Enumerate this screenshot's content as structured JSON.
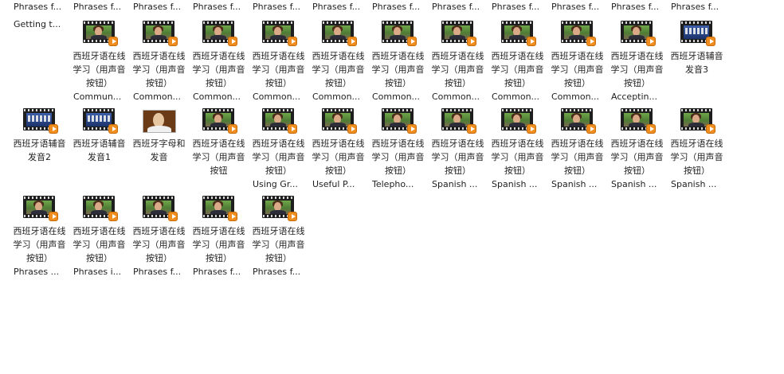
{
  "top_row": [
    "Phrases f...",
    "Phrases f...",
    "Phrases f...",
    "Phrases f...",
    "Phrases f...",
    "Phrases f...",
    "Phrases f...",
    "Phrases f...",
    "Phrases f...",
    "Phrases f...",
    "Phrases f...",
    "Phrases f...",
    "Getting t..."
  ],
  "rows": [
    [
      {
        "thumb": "video",
        "name": "西班牙语在线学习（用声音按钮）",
        "sub": "Commun..."
      },
      {
        "thumb": "video",
        "name": "西班牙语在线学习（用声音按钮）",
        "sub": "Common..."
      },
      {
        "thumb": "video",
        "name": "西班牙语在线学习（用声音按钮）",
        "sub": "Common..."
      },
      {
        "thumb": "video",
        "name": "西班牙语在线学习（用声音按钮）",
        "sub": "Common..."
      },
      {
        "thumb": "video",
        "name": "西班牙语在线学习（用声音按钮）",
        "sub": "Common..."
      },
      {
        "thumb": "video",
        "name": "西班牙语在线学习（用声音按钮）",
        "sub": "Common..."
      },
      {
        "thumb": "video",
        "name": "西班牙语在线学习（用声音按钮）",
        "sub": "Common..."
      },
      {
        "thumb": "video",
        "name": "西班牙语在线学习（用声音按钮）",
        "sub": "Common..."
      },
      {
        "thumb": "video",
        "name": "西班牙语在线学习（用声音按钮）",
        "sub": "Common..."
      },
      {
        "thumb": "video",
        "name": "西班牙语在线学习（用声音按钮）",
        "sub": "Acceptin..."
      },
      {
        "thumb": "blue",
        "name": "西班牙语辅音发音3",
        "sub": ""
      },
      {
        "thumb": "blue",
        "name": "西班牙语辅音发音2",
        "sub": ""
      },
      {
        "thumb": "blue",
        "name": "西班牙语辅音发音1",
        "sub": ""
      }
    ],
    [
      {
        "thumb": "photo",
        "name": "西班牙字母和发音",
        "sub": ""
      },
      {
        "thumb": "video",
        "name": "西班牙语在线学习（用声音按钮",
        "sub": ""
      },
      {
        "thumb": "video",
        "name": "西班牙语在线学习（用声音按钮）",
        "sub": "Using Gr..."
      },
      {
        "thumb": "video",
        "name": "西班牙语在线学习（用声音按钮）",
        "sub": "Useful P..."
      },
      {
        "thumb": "video",
        "name": "西班牙语在线学习（用声音按钮）",
        "sub": "Telepho..."
      },
      {
        "thumb": "video",
        "name": "西班牙语在线学习（用声音按钮）",
        "sub": "Spanish ..."
      },
      {
        "thumb": "video",
        "name": "西班牙语在线学习（用声音按钮）",
        "sub": "Spanish ..."
      },
      {
        "thumb": "video",
        "name": "西班牙语在线学习（用声音按钮）",
        "sub": "Spanish ..."
      },
      {
        "thumb": "video",
        "name": "西班牙语在线学习（用声音按钮）",
        "sub": "Spanish ..."
      },
      {
        "thumb": "video",
        "name": "西班牙语在线学习（用声音按钮）",
        "sub": "Spanish ..."
      },
      {
        "thumb": "video",
        "name": "西班牙语在线学习（用声音按钮）",
        "sub": "Phrases ..."
      },
      {
        "thumb": "video",
        "name": "西班牙语在线学习（用声音按钮）",
        "sub": "Phrases i..."
      },
      {
        "thumb": "video",
        "name": "西班牙语在线学习（用声音按钮）",
        "sub": "Phrases f..."
      }
    ],
    [
      {
        "thumb": "video",
        "name": "西班牙语在线学习（用声音按钮）",
        "sub": "Phrases f..."
      },
      {
        "thumb": "video",
        "name": "西班牙语在线学习（用声音按钮）",
        "sub": "Phrases f..."
      }
    ]
  ]
}
